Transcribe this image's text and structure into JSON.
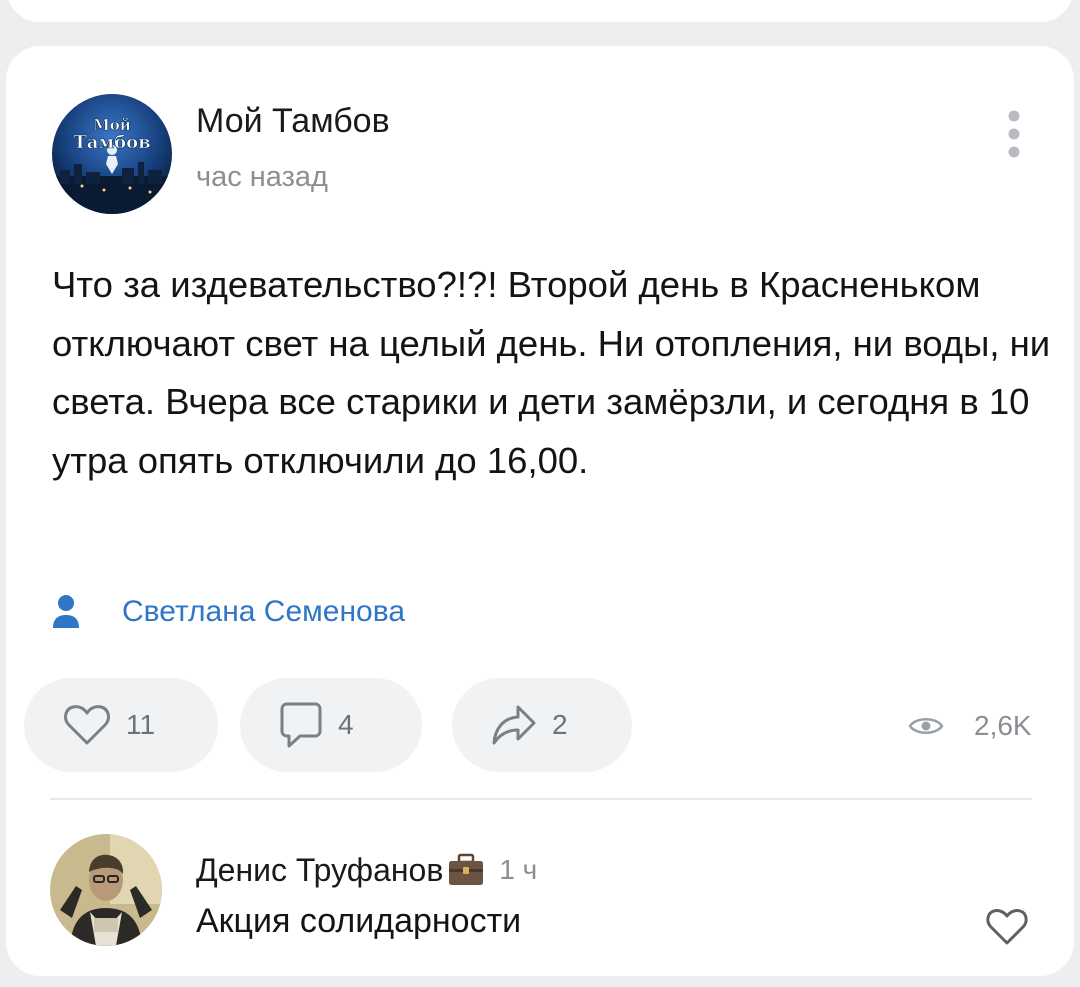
{
  "post": {
    "author": "Мой Тамбов",
    "time": "час назад",
    "avatar_text_line1": "Мой",
    "avatar_text_line2": "Тамбов",
    "text": "Что за издевательство?!?! Второй день в Красненьком отключают свет на целый день. Ни отопления, ни воды, ни света. Вчера все старики и дети замёрзли, и сегодня в 10 утра опять отключили до 16,00.",
    "signer": "Светлана Семенова"
  },
  "actions": {
    "likes": "11",
    "comments": "4",
    "shares": "2",
    "views": "2,6K"
  },
  "comment": {
    "author": "Денис Труфанов",
    "time": "1 ч",
    "text": "Акция солидарности"
  },
  "icons": {
    "more": "more-vertical-icon",
    "signer": "person-icon",
    "like": "heart-outline-icon",
    "comment": "comment-icon",
    "share": "share-arrow-icon",
    "views": "eye-icon",
    "badge": "briefcase-icon"
  },
  "colors": {
    "background": "#edeef0",
    "card": "#ffffff",
    "link": "#2f76c5",
    "pill": "#f0f2f4",
    "secondary_text": "#8b8f94",
    "icon": "#6d7279"
  }
}
